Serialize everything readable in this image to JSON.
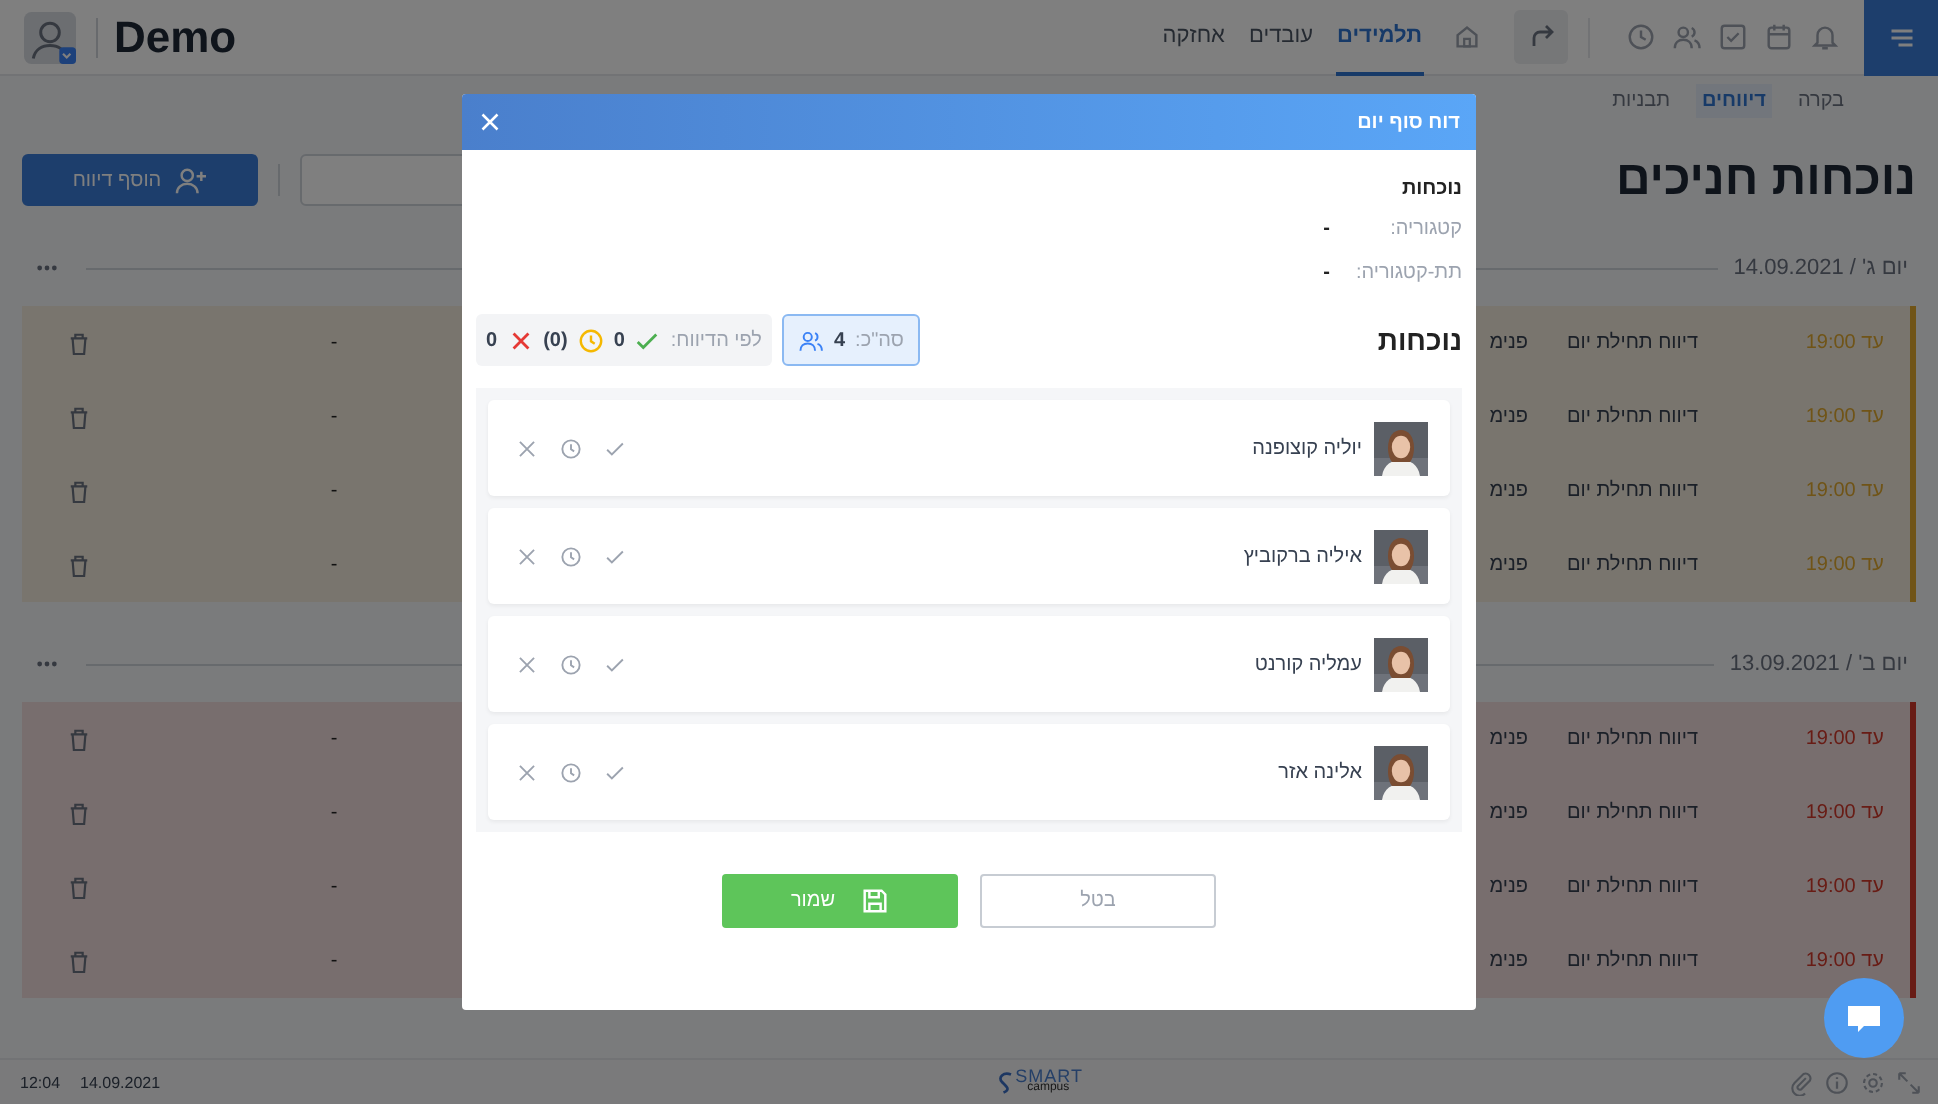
{
  "header": {
    "brand": "Demo",
    "nav_tabs": [
      {
        "label": "תלמידים",
        "selected": true
      },
      {
        "label": "עובדים",
        "selected": false
      },
      {
        "label": "אחזקה",
        "selected": false
      }
    ]
  },
  "sub_tabs": [
    {
      "label": "בקרה",
      "selected": false
    },
    {
      "label": "דיווחים",
      "selected": true
    },
    {
      "label": "תבניות",
      "selected": false
    }
  ],
  "page_title": "נוכחות חניכים",
  "add_button": "הוסף דיווח",
  "groups": [
    {
      "date": "יום ג' / 14.09.2021",
      "color": "#705417",
      "rows": [
        {
          "deadline": "עד 19:00",
          "report": "דיווח תחילת יום",
          "type": "פנימ",
          "value": "-"
        },
        {
          "deadline": "עד 19:00",
          "report": "דיווח תחילת יום",
          "type": "פנימ",
          "value": "-"
        },
        {
          "deadline": "עד 19:00",
          "report": "דיווח תחילת יום",
          "type": "פנימ",
          "value": "-"
        },
        {
          "deadline": "עד 19:00",
          "report": "דיווח תחילת יום",
          "type": "פנימ",
          "value": "-"
        }
      ]
    },
    {
      "date": "יום ב' / 13.09.2021",
      "color": "#681c15",
      "rows": [
        {
          "deadline": "עד 19:00",
          "report": "דיווח תחילת יום",
          "type": "פנימ",
          "value": "-"
        },
        {
          "deadline": "עד 19:00",
          "report": "דיווח תחילת יום",
          "type": "פנימ",
          "value": "-"
        },
        {
          "deadline": "עד 19:00",
          "report": "דיווח תחילת יום",
          "type": "פנימ",
          "value": "-"
        },
        {
          "deadline": "עד 19:00",
          "report": "דיווח תחילת יום",
          "type": "פנימ",
          "value": "-"
        }
      ]
    }
  ],
  "status_bar": {
    "time": "12:04",
    "date": "14.09.2021",
    "logo_top": "SMART",
    "logo_bottom": "campus"
  },
  "modal": {
    "title": "דוח סוף יום",
    "section": "נוכחות",
    "fields": [
      {
        "label": "קטגוריה:",
        "value": "-"
      },
      {
        "label": "תת-קטגוריה:",
        "value": "-"
      }
    ],
    "attendance_title": "נוכחות",
    "total_label": "סה\"כ:",
    "total": "4",
    "by_report_label": "לפי הדיווח:",
    "present": "0",
    "late": "(0)",
    "absent": "0",
    "students": [
      {
        "name": "יוליה קוצופנה"
      },
      {
        "name": "איליה ברקוביץ"
      },
      {
        "name": "עמליה קורנט"
      },
      {
        "name": "אלינה אזר"
      }
    ],
    "save": "שמור",
    "cancel": "בטל"
  }
}
